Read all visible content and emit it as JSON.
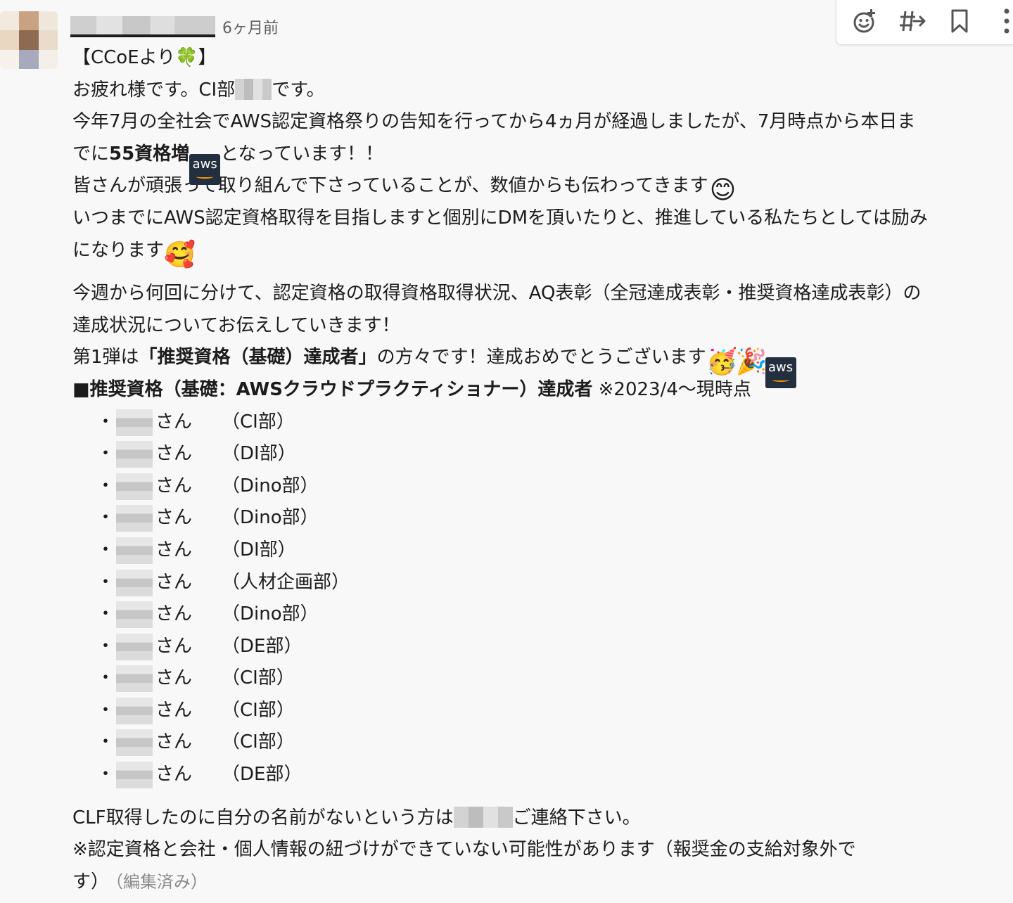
{
  "header": {
    "timestamp": "6ヶ月前"
  },
  "toolbar": {
    "icons": [
      "add-reaction-icon",
      "forward-icon",
      "bookmark-icon",
      "more-icon"
    ]
  },
  "message": {
    "line1": "【CCoEより🍀】",
    "line2a": "お疲れ様です。CI部",
    "line2b": "です。",
    "line3": "今年7月の全社会でAWS認定資格祭りの告知を行ってから4ヵ月が経過しましたが、7月時点から本日ま",
    "line4a": "でに",
    "line4b": "55資格増",
    "line4c": "となっています！！",
    "line5": "皆さんが頑張って取り組んで下さっていることが、数値からも伝わってきます",
    "line6": "いつまでにAWS認定資格取得を目指しますと個別にDMを頂いたりと、推進している私たちとしては励み",
    "line7": "になります",
    "line8": "今週から何回に分けて、認定資格の取得資格取得状況、AQ表彰（全冠達成表彰・推奨資格達成表彰）の",
    "line9": "達成状況についてお伝えしていきます！",
    "line10a": "第1弾は",
    "line10b": "「推奨資格（基礎）達成者」",
    "line10c": "の方々です！達成おめでとうございます",
    "line11a": "■推奨資格（基礎：AWSクラウドプラクティショナー）達成者",
    "line11b": " ※2023/4〜現時点",
    "aws_label": "aws",
    "bullet": "・",
    "san": "さん",
    "depts": [
      "（CI部）",
      "（DI部）",
      "（Dino部）",
      "（Dino部）",
      "（DI部）",
      "（人材企画部）",
      "（Dino部）",
      "（DE部）",
      "（CI部）",
      "（CI部）",
      "（CI部）",
      "（DE部）"
    ],
    "line12a": "CLF取得したのに自分の名前がないという方は",
    "line12b": "ご連絡下さい。",
    "line13": "※認定資格と会社・個人情報の紐づけができていない可能性があります（報奨金の支給対象外で",
    "line14": "す）",
    "edited": "（編集済み）"
  }
}
